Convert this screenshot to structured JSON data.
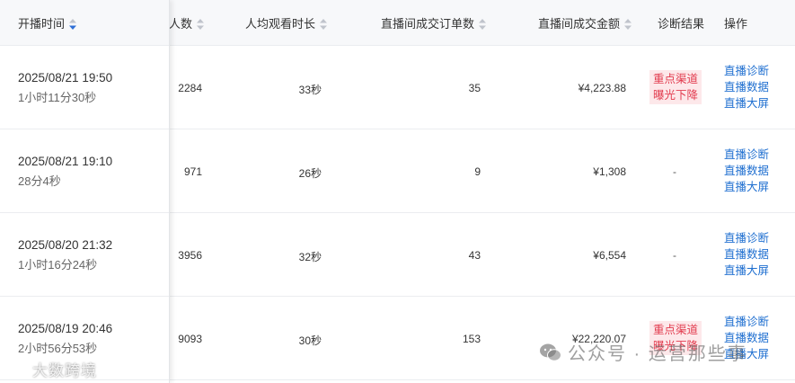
{
  "columns": {
    "start_time": "开播时间",
    "viewers": "人数",
    "avg_watch": "人均观看时长",
    "orders": "直播间成交订单数",
    "gmv": "直播间成交金额",
    "diagnosis": "诊断结果",
    "actions": "操作"
  },
  "rows": [
    {
      "date": "2025/08/21 19:50",
      "duration": "1小时11分30秒",
      "viewers": "2284",
      "avg_watch": "33秒",
      "orders": "35",
      "gmv": "¥4,223.88",
      "tag_lines": [
        "重点渠道",
        "曝光下降"
      ],
      "dash": ""
    },
    {
      "date": "2025/08/21 19:10",
      "duration": "28分4秒",
      "viewers": "971",
      "avg_watch": "26秒",
      "orders": "9",
      "gmv": "¥1,308",
      "tag_lines": [],
      "dash": "-"
    },
    {
      "date": "2025/08/20 21:32",
      "duration": "1小时16分24秒",
      "viewers": "3956",
      "avg_watch": "32秒",
      "orders": "43",
      "gmv": "¥6,554",
      "tag_lines": [],
      "dash": "-"
    },
    {
      "date": "2025/08/19 20:46",
      "duration": "2小时56分53秒",
      "viewers": "9093",
      "avg_watch": "30秒",
      "orders": "153",
      "gmv": "¥22,220.07",
      "tag_lines": [
        "重点渠道",
        "曝光下降"
      ],
      "dash": ""
    }
  ],
  "actions": [
    "直播诊断",
    "直播数据",
    "直播大屏"
  ],
  "watermarks": {
    "left": "大数跨境",
    "right": "公众号 · 运营那些事"
  },
  "colors": {
    "link": "#1f6fd0",
    "tag_text": "#e23c4f",
    "tag_bg": "#fde8ea",
    "sort_active": "#2f6fd6",
    "sort_inactive": "#c0c4cc"
  }
}
